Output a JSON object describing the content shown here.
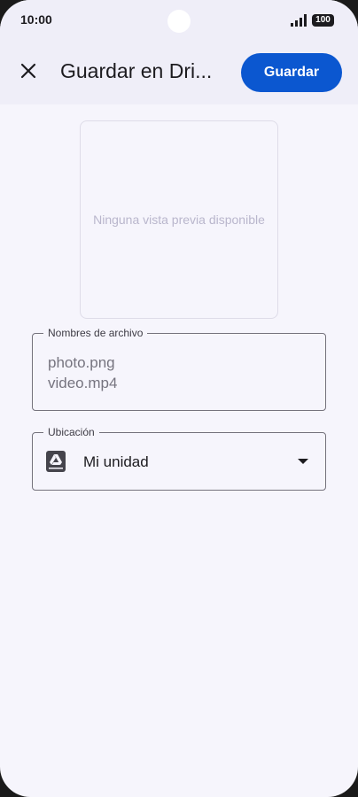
{
  "status_bar": {
    "time": "10:00",
    "battery": "100"
  },
  "app_bar": {
    "title": "Guardar en Dri...",
    "save_label": "Guardar"
  },
  "preview": {
    "empty_text": "Ninguna vista previa disponible"
  },
  "file_names_field": {
    "label": "Nombres de archivo",
    "files": [
      "photo.png",
      "video.mp4"
    ]
  },
  "location_field": {
    "label": "Ubicación",
    "value": "Mi unidad",
    "icon": "drive-icon"
  },
  "colors": {
    "accent": "#0b57d0",
    "background": "#f6f5fc",
    "topbar": "#efeef8"
  }
}
